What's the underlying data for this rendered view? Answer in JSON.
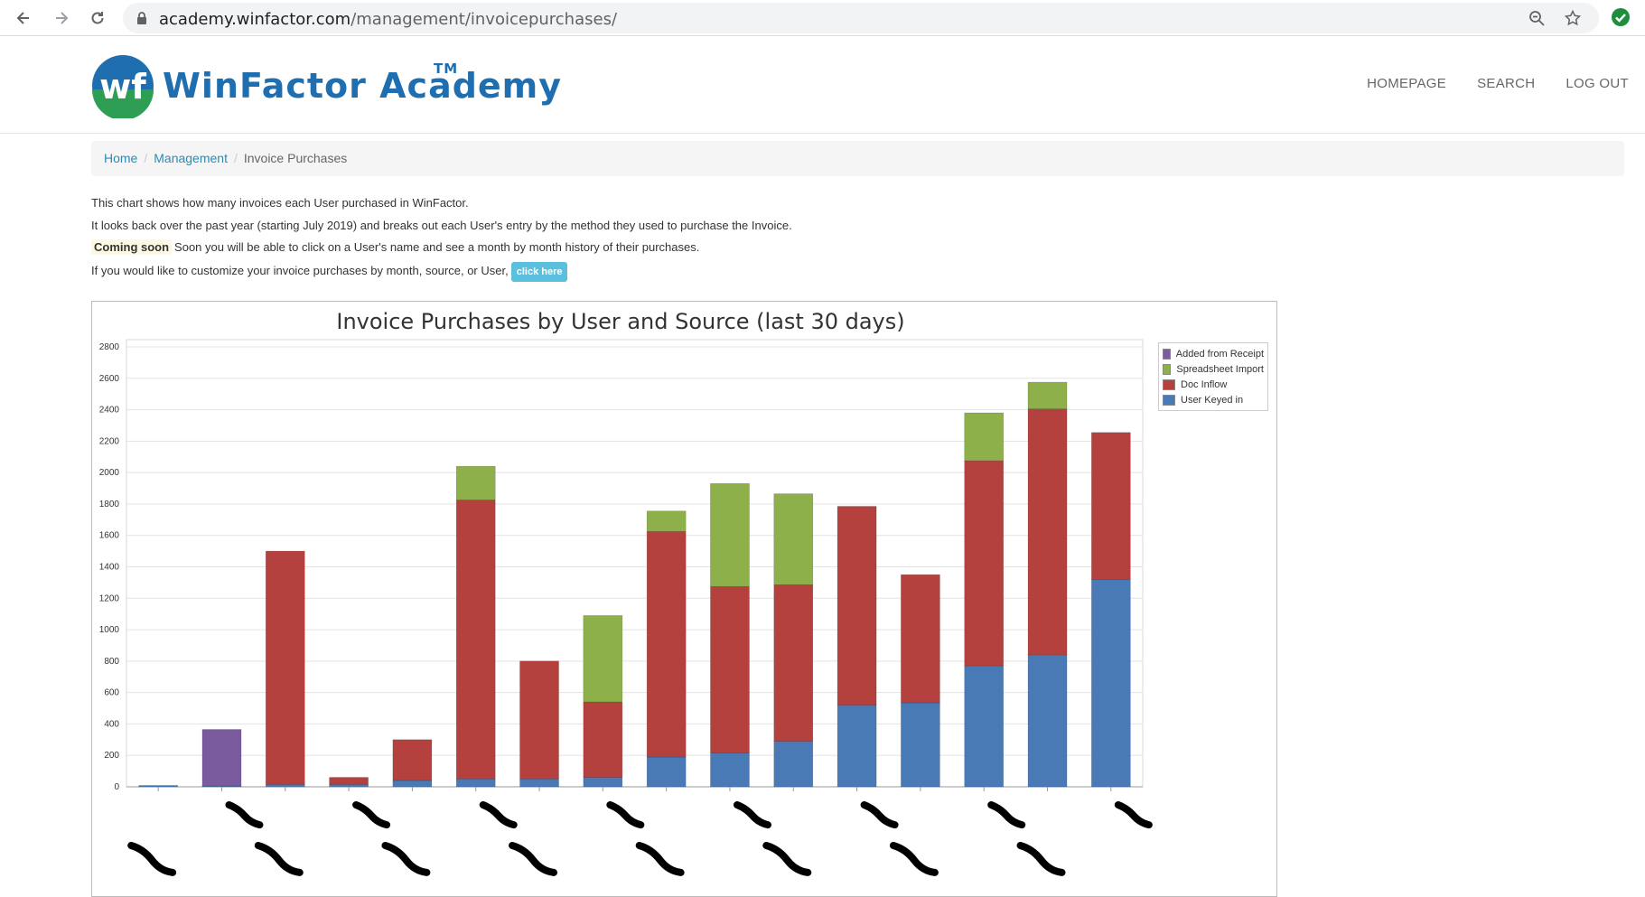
{
  "browser": {
    "url_host": "academy.winfactor.com",
    "url_path": "/management/invoicepurchases/"
  },
  "site": {
    "logo_mark": "wf",
    "logo_text": "WinFactor Academy",
    "logo_tm": "TM",
    "nav": [
      "HOMEPAGE",
      "SEARCH",
      "LOG OUT"
    ]
  },
  "breadcrumb": {
    "home": "Home",
    "management": "Management",
    "current": "Invoice Purchases"
  },
  "intro": {
    "line1": "This chart shows how many invoices each User purchased in WinFactor.",
    "line2": "It looks back over the past year (starting July 2019) and breaks out each User's entry by the method they used to purchase the Invoice.",
    "coming_soon_badge": "Coming soon",
    "line3": "Soon you will be able to click on a User's name and see a month by month history of their purchases.",
    "line4": "If you would like to customize your invoice purchases by month, source, or User,",
    "click_here": "click here"
  },
  "colors": {
    "user_keyed": "#4a7ab5",
    "doc_inflow": "#b5413e",
    "spreadsheet": "#8db04a",
    "receipt": "#7a5b9e",
    "accent_link": "#2a8bb8",
    "button": "#5bc0de"
  },
  "chart_data": {
    "type": "bar",
    "stacked": true,
    "title": "Invoice Purchases by User and Source (last 30 days)",
    "ylim": [
      0,
      2800
    ],
    "yticks": [
      0,
      200,
      400,
      600,
      800,
      1000,
      1200,
      1400,
      1600,
      1800,
      2000,
      2200,
      2400,
      2600,
      2800
    ],
    "grid": true,
    "legend_position": "top-right",
    "categories_redacted": true,
    "categories": [
      "",
      "",
      "",
      "",
      "",
      "",
      "",
      "",
      "",
      "",
      "",
      "",
      "",
      "",
      "",
      "",
      ""
    ],
    "series": [
      {
        "name": "User Keyed in",
        "color": "#4a7ab5",
        "values": [
          8,
          5,
          15,
          15,
          40,
          50,
          50,
          60,
          190,
          215,
          290,
          520,
          535,
          770,
          840,
          1320
        ]
      },
      {
        "name": "Doc Inflow",
        "color": "#b5413e",
        "values": [
          0,
          0,
          1485,
          45,
          260,
          1775,
          750,
          480,
          1435,
          1060,
          995,
          1265,
          815,
          1305,
          1565,
          935
        ]
      },
      {
        "name": "Spreadsheet Import",
        "color": "#8db04a",
        "values": [
          0,
          0,
          0,
          0,
          0,
          215,
          0,
          550,
          130,
          655,
          580,
          0,
          0,
          305,
          170,
          0
        ]
      },
      {
        "name": "Added from Receipt",
        "color": "#7a5b9e",
        "values": [
          0,
          360,
          0,
          0,
          0,
          0,
          0,
          0,
          0,
          0,
          0,
          0,
          0,
          0,
          0,
          0
        ]
      }
    ]
  }
}
